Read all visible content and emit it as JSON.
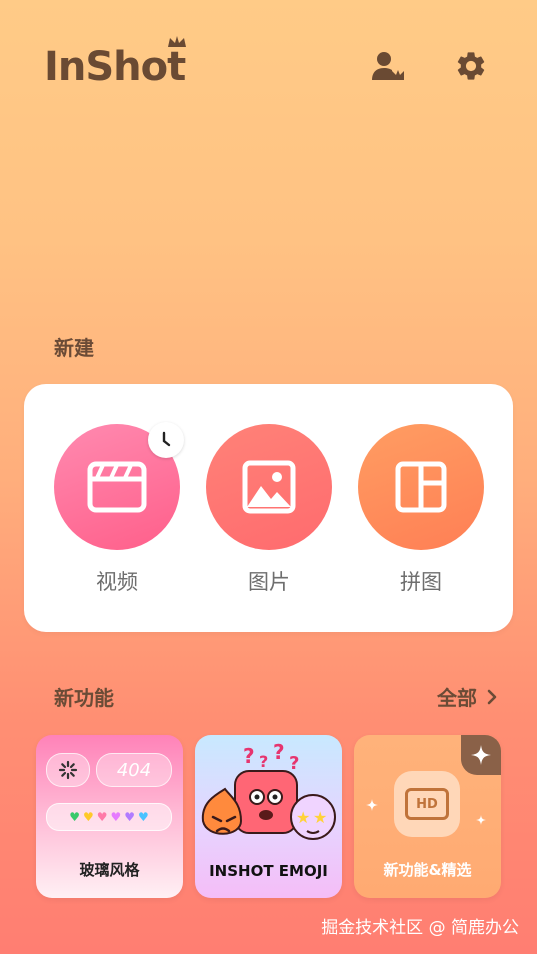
{
  "header": {
    "logo_text": "InShot",
    "profile_icon": "user-crown-icon",
    "settings_icon": "gear-icon"
  },
  "create_section": {
    "title": "新建",
    "items": [
      {
        "label": "视频",
        "icon": "clapperboard-icon",
        "badge_icon": "clock-icon",
        "color_from": "#ff8ab0",
        "color_to": "#ff5f8a"
      },
      {
        "label": "图片",
        "icon": "image-icon",
        "color_from": "#ff8278",
        "color_to": "#ff6e6e"
      },
      {
        "label": "拼图",
        "icon": "collage-icon",
        "color_from": "#ff9d62",
        "color_to": "#ff7f55"
      }
    ]
  },
  "features_section": {
    "title": "新功能",
    "see_all_label": "全部",
    "cards": [
      {
        "label": "玻璃风格",
        "pill_text": "404"
      },
      {
        "label": "INSHOT EMOJI"
      },
      {
        "label": "新功能&精选",
        "badge": "HD"
      }
    ]
  },
  "watermark": "掘金技术社区 @ 简鹿办公"
}
